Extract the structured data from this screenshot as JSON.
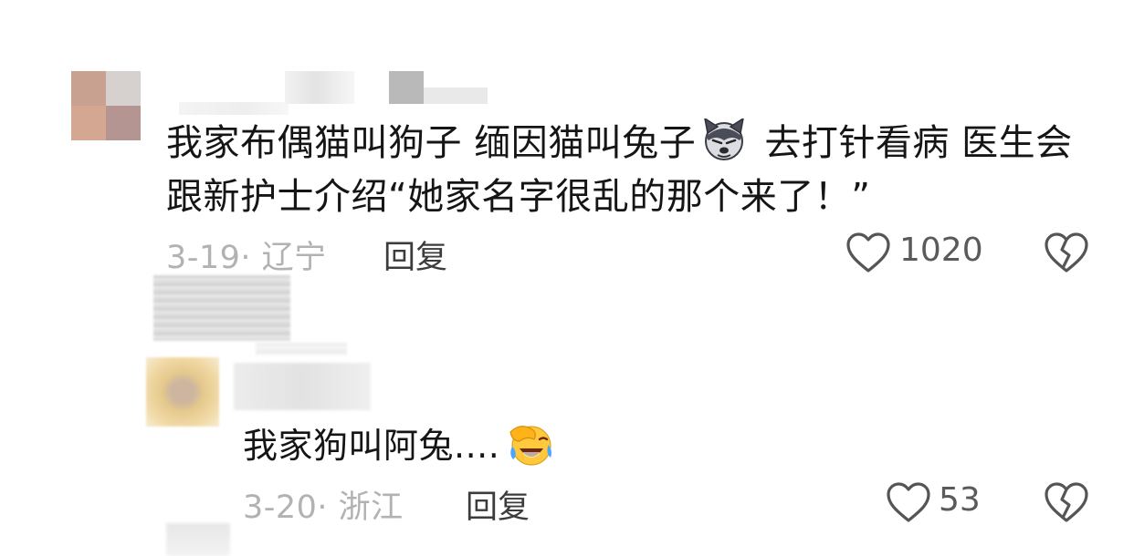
{
  "comment_1": {
    "text_part_1": "我家布偶猫叫狗子 缅因猫叫兔子",
    "inline_emoji": "husky-dog-face-icon",
    "text_part_2": " 去打针看病 医生会跟新护士介绍“她家名字很乱的那个来了！”",
    "date_location": "3-19· 辽宁",
    "reply_label": "回复",
    "like_count": "1020",
    "like_icon": "heart-outline-icon",
    "dislike_icon": "broken-heart-icon"
  },
  "comment_2": {
    "text": "我家狗叫阿兔....",
    "inline_emoji": "facepalm-laughing-crying-icon",
    "date_location": "3-20· 浙江",
    "reply_label": "回复",
    "like_count": "53",
    "like_icon": "heart-outline-icon",
    "dislike_icon": "broken-heart-icon"
  },
  "colors": {
    "text_primary": "#151515",
    "text_meta": "#b2b2b2",
    "icon_gray": "#555555",
    "emoji_yellow": "#ffc83d"
  }
}
